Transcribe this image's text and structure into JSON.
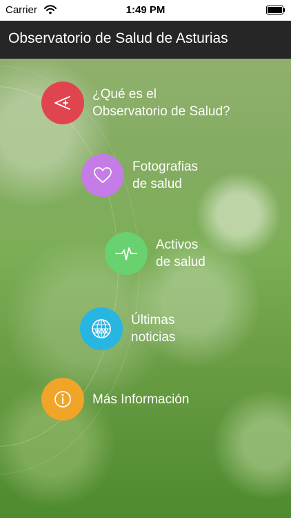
{
  "status_bar": {
    "carrier": "Carrier",
    "time": "1:49 PM"
  },
  "nav": {
    "title": "Observatorio de Salud de Asturias"
  },
  "menu": {
    "items": [
      {
        "line1": "¿Qué es el",
        "line2": "Observatorio de Salud?",
        "icon": "chart-icon",
        "color": "#e0454f"
      },
      {
        "line1": "Fotografias",
        "line2": "de salud",
        "icon": "heart-icon",
        "color": "#c57ce6"
      },
      {
        "line1": "Activos",
        "line2": "de salud",
        "icon": "pulse-icon",
        "color": "#69d16f"
      },
      {
        "line1": "Últimas",
        "line2": "noticias",
        "icon": "globe-icon",
        "color": "#27b6e2"
      },
      {
        "line1": "Más Información",
        "line2": "",
        "icon": "info-icon",
        "color": "#f0a428"
      }
    ]
  }
}
